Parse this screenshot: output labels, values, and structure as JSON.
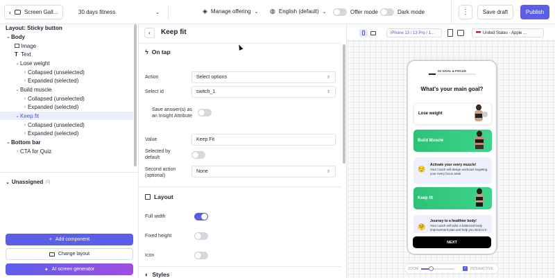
{
  "topbar": {
    "screen_name": "Screen Gall...",
    "program_name": "30 days fitness",
    "manage_offering": "Manage offering",
    "language": "English (default)",
    "offer_mode_label": "Offer mode",
    "dark_mode_label": "Dark mode",
    "save_draft": "Save draft",
    "publish": "Publish",
    "accent_color": "#5b5fe8"
  },
  "left_panel": {
    "layout_title": "Layout: Sticky button",
    "tree": [
      {
        "label": "Body",
        "bold": true
      },
      {
        "label": "Image"
      },
      {
        "label": "Text"
      },
      {
        "label": "Lose weight"
      },
      {
        "label": "Collapsed (unselected)"
      },
      {
        "label": "Expanded (selected)"
      },
      {
        "label": "Build muscle"
      },
      {
        "label": "Collapsed (unselected)"
      },
      {
        "label": "Expanded (selected)"
      },
      {
        "label": "Keep fit",
        "selected": true
      },
      {
        "label": "Collapsed (unselected)"
      },
      {
        "label": "Expanded (selected)"
      },
      {
        "label": "Bottom bar",
        "bold": true
      },
      {
        "label": "CTA for Quiz"
      }
    ],
    "unassigned_label": "Unassigned",
    "unassigned_count": "(0)",
    "add_component": "Add component",
    "change_layout": "Change layout",
    "ai_generator": "AI screen generator"
  },
  "middle_panel": {
    "title": "Keep fit",
    "on_tap_title": "On tap",
    "action_label": "Action",
    "action_value": "Select options",
    "select_id_label": "Select id",
    "select_id_value": "switch_1",
    "save_answers_label_1": "Save answer(s) as",
    "save_answers_label_2": "an Insight Attribute",
    "value_label": "Value",
    "value_value": "Keep Fit",
    "selected_default_label_1": "Selected by",
    "selected_default_label_2": "default",
    "second_action_label_1": "Second action",
    "second_action_label_2": "(optional)",
    "second_action_value": "None",
    "layout_title": "Layout",
    "full_width_label": "Full width",
    "fixed_height_label": "Fixed height",
    "icon_label": "Icon",
    "styles_title": "Styles"
  },
  "preview": {
    "device": "iPhone 13 / 13 Pro / 1...",
    "region": "United States - Apple ...",
    "zoom_label": "ZOOM",
    "zoom_level": 0.3,
    "interactive_label": "INTERACTIVE",
    "phone": {
      "step_label": "01 GOAL & FOCUS",
      "heading": "What's your main goal?",
      "cards": [
        {
          "title": "Lose weight",
          "style": "plain"
        },
        {
          "title": "Build Muscle",
          "style": "green"
        },
        {
          "title": "Activate your every muscle!",
          "body": "Your coach will design workouts targeting your every focus area!",
          "style": "info",
          "emoji": "😌"
        },
        {
          "title": "Keep fit",
          "style": "green"
        },
        {
          "title": "Journey to a healthier body!",
          "body": "Your coach will tailor a balanced body improvement plan and help you stick to it",
          "style": "info",
          "emoji": "🤗"
        }
      ],
      "next_button": "NEXT"
    }
  }
}
